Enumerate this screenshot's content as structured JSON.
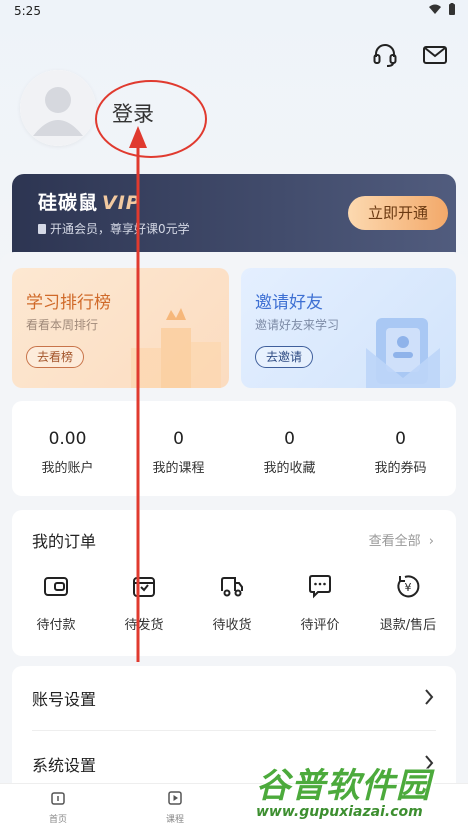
{
  "status_bar": {
    "time": "5:25"
  },
  "header": {
    "icons": [
      "headset-icon",
      "mail-icon"
    ]
  },
  "profile": {
    "login_label": "登录"
  },
  "vip": {
    "title": "硅碳鼠",
    "title_suffix": "VIP",
    "subtitle": "开通会员，尊享好课0元学",
    "button_label": "立即开通",
    "colors": {
      "card": "#2d3552",
      "accent": "#f3a96a"
    }
  },
  "promos": [
    {
      "title": "学习排行榜",
      "subtitle": "看看本周排行",
      "button_label": "去看榜"
    },
    {
      "title": "邀请好友",
      "subtitle": "邀请好友来学习",
      "button_label": "去邀请"
    }
  ],
  "stats": [
    {
      "value": "0.00",
      "label": "我的账户"
    },
    {
      "value": "0",
      "label": "我的课程"
    },
    {
      "value": "0",
      "label": "我的收藏"
    },
    {
      "value": "0",
      "label": "我的券码"
    }
  ],
  "orders": {
    "title": "我的订单",
    "view_all": "查看全部",
    "items": [
      {
        "label": "待付款",
        "icon": "wallet-icon"
      },
      {
        "label": "待发货",
        "icon": "package-icon"
      },
      {
        "label": "待收货",
        "icon": "truck-icon"
      },
      {
        "label": "待评价",
        "icon": "chat-icon"
      },
      {
        "label": "退款/售后",
        "icon": "refund-icon"
      }
    ]
  },
  "settings": [
    {
      "label": "账号设置"
    },
    {
      "label": "系统设置"
    }
  ],
  "tab_bar": [
    {
      "label": "首页",
      "icon": "home-icon"
    },
    {
      "label": "课程",
      "icon": "play-icon"
    }
  ],
  "watermark": {
    "text": "谷普软件园",
    "url": "www.gupuxiazai.com"
  }
}
